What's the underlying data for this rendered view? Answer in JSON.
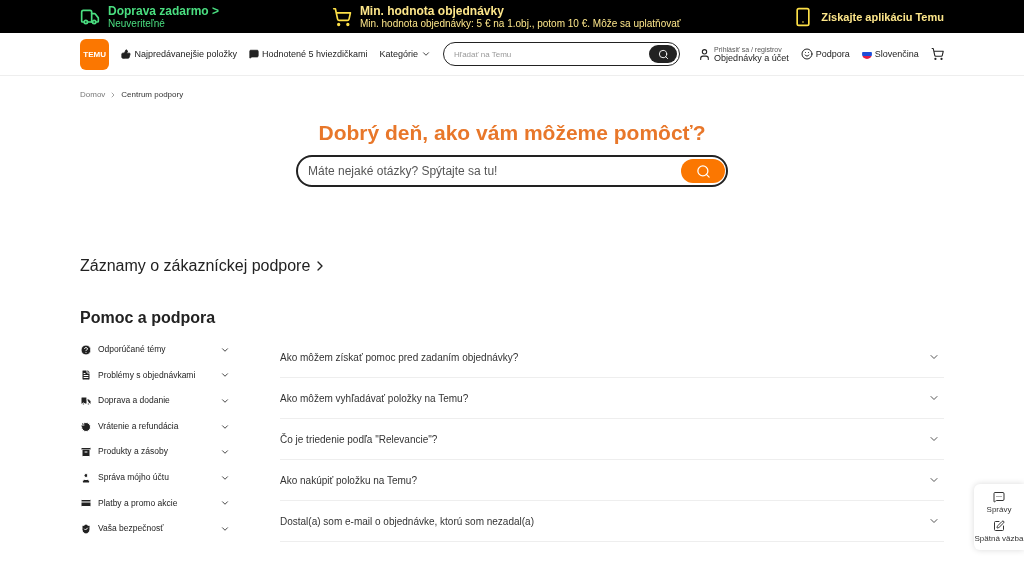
{
  "promo_bar": {
    "shipping": {
      "title": "Doprava zadarmo",
      "arrow": ">",
      "subtitle": "Neuveriteľné"
    },
    "minimum": {
      "title": "Min. hodnota objednávky",
      "subtitle": "Min. hodnota objednávky: 5 € na 1.obj., potom 10 €. Môže sa uplatňovať"
    },
    "app": {
      "title": "Získajte aplikáciu Temu"
    }
  },
  "header": {
    "logo": "TEMU",
    "nav": [
      {
        "label": "Najpredávanejšie položky"
      },
      {
        "label": "Hodnotené 5 hviezdičkami"
      },
      {
        "label": "Kategórie"
      }
    ],
    "search": {
      "placeholder": "Hľadať na Temu"
    },
    "account": {
      "small": "Prihlásiť sa / registrov",
      "main": "Objednávky a účet"
    },
    "support": "Podpora",
    "language": "Slovenčina"
  },
  "breadcrumb": [
    "Domov",
    "Centrum podpory"
  ],
  "hero": {
    "title": "Dobrý deň, ako vám môžeme pomôcť?",
    "search": {
      "placeholder": "Máte nejaké otázky? Spýtajte sa tu!"
    }
  },
  "records_link": "Záznamy o zákazníckej podpore",
  "help": {
    "title": "Pomoc a podpora",
    "topics": [
      {
        "label": "Odporúčané témy",
        "expanded": false
      },
      {
        "label": "Problémy s objednávkami",
        "expanded": false
      },
      {
        "label": "Doprava a dodanie",
        "expanded": false
      },
      {
        "label": "Vrátenie a refundácia",
        "expanded": false
      },
      {
        "label": "Produkty a zásoby",
        "expanded": false
      },
      {
        "label": "Správa mójho účtu",
        "expanded": false
      },
      {
        "label": "Platby a promo akcie",
        "expanded": false
      },
      {
        "label": "Vaša bezpečnosť",
        "expanded": false
      }
    ],
    "questions": [
      {
        "text": "Ako môžem získať pomoc pred zadaním objednávky?",
        "expanded": false
      },
      {
        "text": "Ako môžem vyhľadávať položky na Temu?",
        "expanded": false
      },
      {
        "text": "Čo je triedenie podľa \"Relevancie\"?",
        "expanded": false
      },
      {
        "text": "Ako nakúpiť položku na Temu?",
        "expanded": false
      },
      {
        "text": "Dostal(a) som e-mail o objednávke, ktorú som nezadal(a)",
        "expanded": false
      }
    ]
  },
  "side_widget": [
    {
      "label": "Správy"
    },
    {
      "label": "Spätná väzba"
    }
  ]
}
